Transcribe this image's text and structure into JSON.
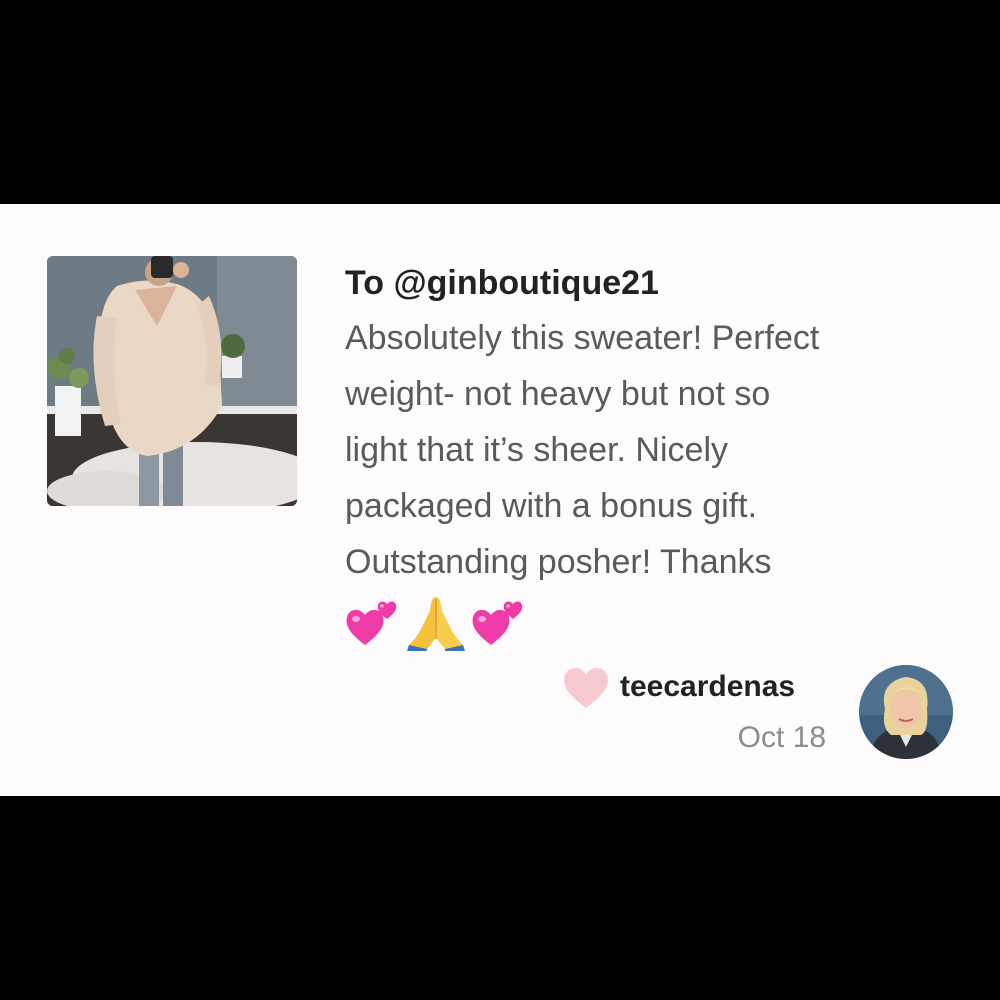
{
  "note": {
    "recipient": "To @ginboutique21",
    "message": "Absolutely this sweater! Perfect\nweight- not heavy but not so\nlight that it’s sheer. Nicely\npackaged with a bonus gift.\nOutstanding posher! Thanks",
    "emojis": [
      "two-hearts-icon",
      "folded-hands-icon",
      "two-hearts-icon"
    ]
  },
  "author": {
    "username": "teecardenas",
    "date": "Oct 18"
  },
  "colors": {
    "card_background": "#fdfbfc",
    "heart": "#f8c8cf",
    "emoji_heart": "#f03ca8",
    "text_primary": "#222222",
    "text_body": "#5a5a5a",
    "text_muted": "#8c8c8c"
  }
}
